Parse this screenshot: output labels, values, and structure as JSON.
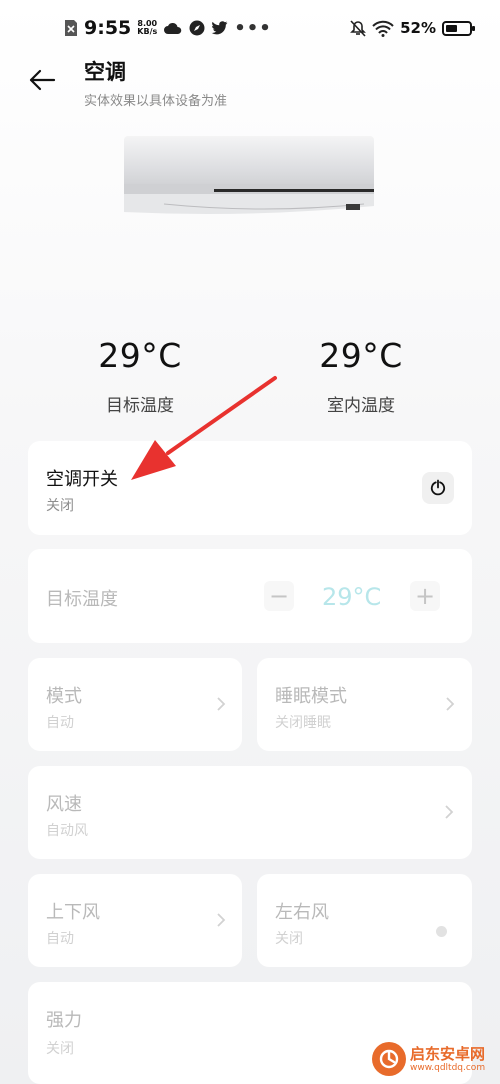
{
  "status_bar": {
    "time": "9:55",
    "speed_value": "8.00",
    "speed_unit": "KB/s",
    "battery": "52%",
    "battery_level": 0.52,
    "more": "•••"
  },
  "header": {
    "title": "空调",
    "subtitle": "实体效果以具体设备为准"
  },
  "temps": {
    "target": {
      "value": "29°C",
      "label": "目标温度"
    },
    "indoor": {
      "value": "29°C",
      "label": "室内温度"
    }
  },
  "controls": {
    "power": {
      "title": "空调开关",
      "status": "关闭"
    },
    "target_temp": {
      "title": "目标温度",
      "value": "29°C",
      "minus": "−",
      "plus": "+"
    },
    "mode": {
      "title": "模式",
      "status": "自动"
    },
    "sleep": {
      "title": "睡眠模式",
      "status": "关闭睡眠"
    },
    "fan_speed": {
      "title": "风速",
      "status": "自动风"
    },
    "vertical_swing": {
      "title": "上下风",
      "status": "自动"
    },
    "horizontal_swing": {
      "title": "左右风",
      "status": "关闭"
    },
    "turbo": {
      "title": "强力",
      "status": "关闭"
    }
  },
  "watermark": {
    "name": "启东安卓网",
    "url": "www.qdltdq.com"
  },
  "colors": {
    "annotation_arrow": "#e8322f",
    "watermark": "#e86b2b",
    "disabled_value": "#b7e6ea"
  }
}
